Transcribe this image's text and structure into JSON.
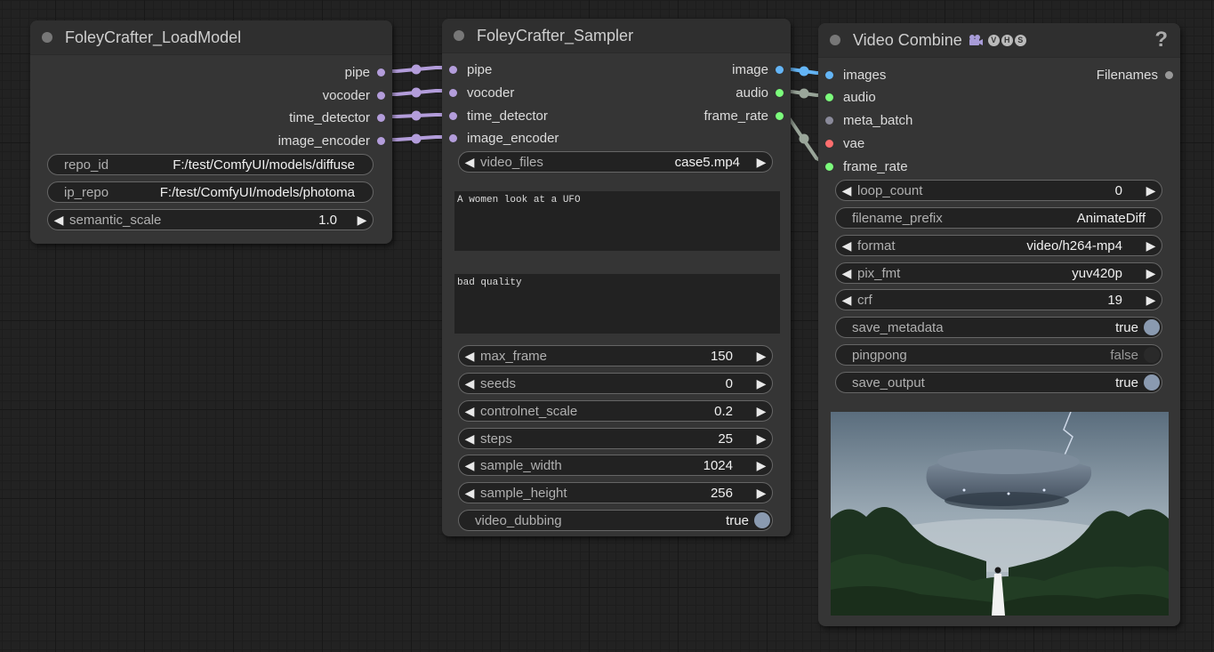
{
  "nodes": {
    "load_model": {
      "title": "FoleyCrafter_LoadModel",
      "outputs": [
        "pipe",
        "vocoder",
        "time_detector",
        "image_encoder"
      ],
      "widgets": {
        "repo_id": {
          "label": "repo_id",
          "value": "F:/test/ComfyUI/models/diffuse"
        },
        "ip_repo": {
          "label": "ip_repo",
          "value": "F:/test/ComfyUI/models/photoma"
        },
        "semantic_scale": {
          "label": "semantic_scale",
          "value": "1.0"
        }
      }
    },
    "sampler": {
      "title": "FoleyCrafter_Sampler",
      "inputs": [
        "pipe",
        "vocoder",
        "time_detector",
        "image_encoder"
      ],
      "outputs": [
        "image",
        "audio",
        "frame_rate"
      ],
      "video_files": {
        "label": "video_files",
        "value": "case5.mp4"
      },
      "prompt_text": "A women look at a UFO",
      "negative_text": "bad quality",
      "widgets": {
        "max_frame": {
          "label": "max_frame",
          "value": "150"
        },
        "seeds": {
          "label": "seeds",
          "value": "0"
        },
        "controlnet_scale": {
          "label": "controlnet_scale",
          "value": "0.2"
        },
        "steps": {
          "label": "steps",
          "value": "25"
        },
        "sample_width": {
          "label": "sample_width",
          "value": "1024"
        },
        "sample_height": {
          "label": "sample_height",
          "value": "256"
        },
        "video_dubbing": {
          "label": "video_dubbing",
          "value": "true"
        }
      }
    },
    "video_combine": {
      "title": "Video Combine",
      "badges": [
        "V",
        "H",
        "S"
      ],
      "help": "?",
      "inputs": [
        "images",
        "audio",
        "meta_batch",
        "vae",
        "frame_rate"
      ],
      "outputs": [
        "Filenames"
      ],
      "widgets": {
        "loop_count": {
          "label": "loop_count",
          "value": "0"
        },
        "filename_prefix": {
          "label": "filename_prefix",
          "value": "AnimateDiff"
        },
        "format": {
          "label": "format",
          "value": "video/h264-mp4"
        },
        "pix_fmt": {
          "label": "pix_fmt",
          "value": "yuv420p"
        },
        "crf": {
          "label": "crf",
          "value": "19"
        },
        "save_metadata": {
          "label": "save_metadata",
          "value": "true"
        },
        "pingpong": {
          "label": "pingpong",
          "value": "false"
        },
        "save_output": {
          "label": "save_output",
          "value": "true"
        }
      }
    }
  },
  "icons": {
    "arrow_left": "◀",
    "arrow_right": "▶",
    "node_status": "circle-icon",
    "video_combine": "camera-icon"
  },
  "colors": {
    "pipe_slot": "#b39ddb",
    "image_slot": "#64b5f6",
    "audio_slot": "#7cfc7c",
    "int_slot": "#7cfc7c",
    "vae_slot": "#ff6e6e",
    "meta_slot": "#8a8a9a",
    "out_slot": "#999999",
    "pipe_wire": "#b39ddb",
    "image_wire": "#64b5f6",
    "audio_wire": "#9aa69a",
    "toggle_on": "#8a9ab0",
    "toggle_off": "#2a2a2a"
  }
}
